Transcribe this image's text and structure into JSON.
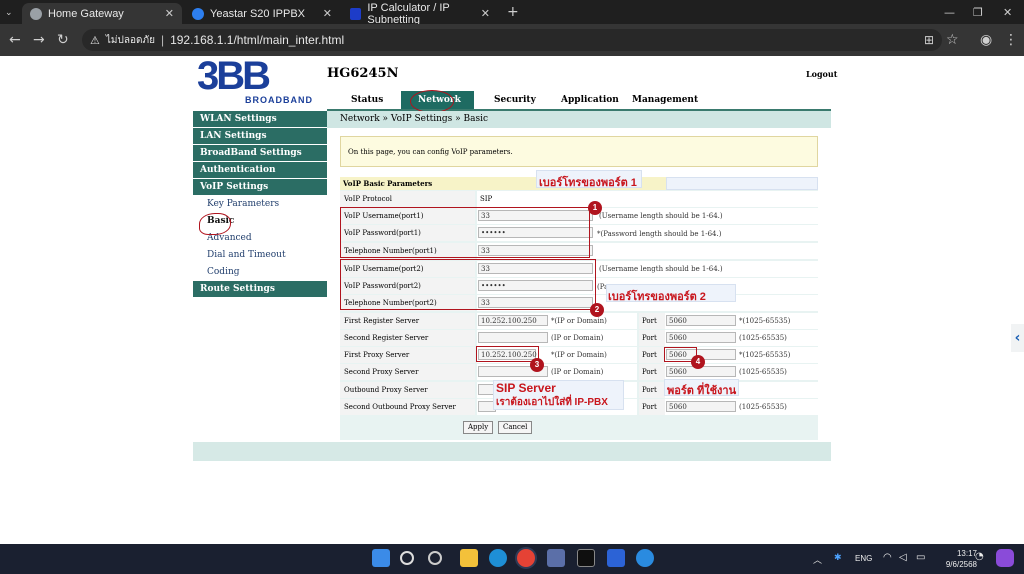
{
  "browser": {
    "tabs": [
      {
        "label": "Home Gateway",
        "active": true
      },
      {
        "label": "Yeastar S20 IPPBX",
        "active": false
      },
      {
        "label": "IP Calculator / IP Subnetting",
        "active": false
      }
    ],
    "new_tab": "+",
    "security_label": "ไม่ปลอดภัย",
    "url": "192.168.1.1/html/main_inter.html"
  },
  "header": {
    "brand_main": "3BB",
    "brand_sub": "BROADBAND",
    "model": "HG6245N",
    "logout": "Logout",
    "menu": [
      "Status",
      "Network",
      "Security",
      "Application",
      "Management"
    ]
  },
  "sidebar": {
    "items": [
      {
        "label": "WLAN Settings",
        "type": "header"
      },
      {
        "label": "LAN Settings",
        "type": "header"
      },
      {
        "label": "BroadBand Settings",
        "type": "header"
      },
      {
        "label": "Authentication",
        "type": "header"
      },
      {
        "label": "VoIP Settings",
        "type": "header"
      },
      {
        "label": "Key Parameters",
        "type": "sub"
      },
      {
        "label": "Basic",
        "type": "sub",
        "active": true
      },
      {
        "label": "Advanced",
        "type": "sub"
      },
      {
        "label": "Dial and Timeout",
        "type": "sub"
      },
      {
        "label": "Coding",
        "type": "sub"
      },
      {
        "label": "Route Settings",
        "type": "header"
      }
    ]
  },
  "breadcrumb": "Network » VoIP Settings » Basic",
  "info_text": "On this page, you can config VoIP parameters.",
  "form": {
    "title": "VoIP Basic Parameters",
    "protocol_label": "VoIP Protocol",
    "protocol_value": "SIP",
    "port1": {
      "username_label": "VoIP Username(port1)",
      "username_value": "33",
      "username_hint": "(Username length should be 1-64.)",
      "password_label": "VoIP Password(port1)",
      "password_value": "••••••",
      "password_hint": "*(Password length should be 1-64.)",
      "tel_label": "Telephone Number(port1)",
      "tel_value": "33"
    },
    "port2": {
      "username_label": "VoIP Username(port2)",
      "username_value": "33",
      "username_hint": "(Username length should be 1-64.)",
      "password_label": "VoIP Password(port2)",
      "password_value": "••••••",
      "password_hint": "(Pa",
      "tel_label": "Telephone Number(port2)",
      "tel_value": "33"
    },
    "servers": [
      {
        "label": "First Register Server",
        "value": "10.252.100.250",
        "hint": "*(IP or Domain)",
        "port": "5060",
        "port_hint": "*(1025-65535)"
      },
      {
        "label": "Second Register Server",
        "value": "",
        "hint": "(IP or Domain)",
        "port": "5060",
        "port_hint": "(1025-65535)"
      },
      {
        "label": "First Proxy Server",
        "value": "10.252.100.250",
        "hint": "*(IP or Domain)",
        "port": "5060",
        "port_hint": "*(1025-65535)"
      },
      {
        "label": "Second Proxy Server",
        "value": "",
        "hint": "(IP or Domain)",
        "port": "5060",
        "port_hint": "(1025-65535)"
      },
      {
        "label": "Outbound Proxy Server",
        "value": "",
        "hint": "",
        "port": "",
        "port_hint": ""
      },
      {
        "label": "Second Outbound Proxy Server",
        "value": "",
        "hint": "",
        "port": "5060",
        "port_hint": "(1025-65535)"
      }
    ],
    "port_label": "Port",
    "apply": "Apply",
    "cancel": "Cancel"
  },
  "annotations": {
    "port1_note": "เบอร์โทรของพอร์ต 1",
    "port2_note": "เบอร์โทรของพอร์ต 2",
    "sip_title": "SIP Server",
    "sip_note": "เราต้องเอาไปใส่ที่ IP-PBX",
    "port_note": "พอร์ต ที่ใช้งาน",
    "numbers": [
      "1",
      "2",
      "3",
      "4"
    ]
  },
  "taskbar": {
    "lang": "ENG",
    "time": "13:17",
    "date": "9/6/2568"
  },
  "colors": {
    "accent": "#2b6d64",
    "annotation": "#b0141e"
  }
}
